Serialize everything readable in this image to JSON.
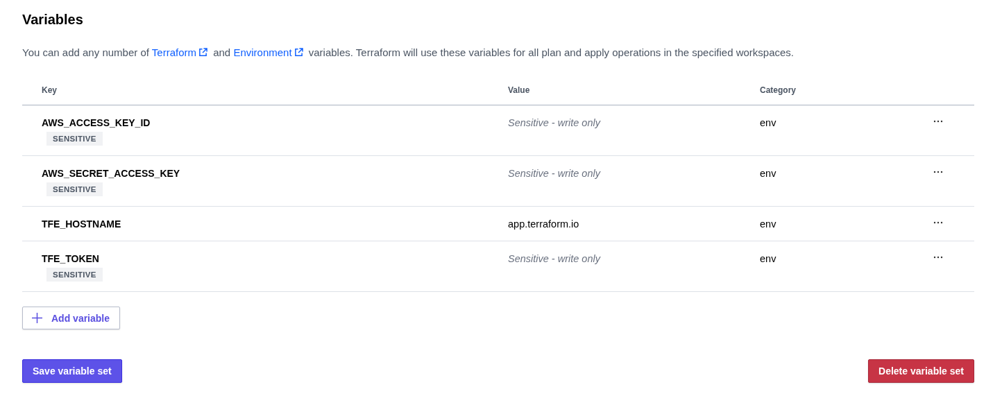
{
  "title": "Variables",
  "description": [
    {
      "kind": "text",
      "text": "You can add any number of "
    },
    {
      "kind": "link",
      "text": "Terraform"
    },
    {
      "kind": "text",
      "text": " and "
    },
    {
      "kind": "link",
      "text": "Environment"
    },
    {
      "kind": "text",
      "text": " variables. Terraform will use these variables for all plan and apply operations in the specified workspaces."
    }
  ],
  "table": {
    "columns": [
      "Key",
      "Value",
      "Category"
    ],
    "rows": [
      {
        "key": "AWS_ACCESS_KEY_ID",
        "badge": "SENSITIVE",
        "value": "Sensitive - write only",
        "masked": true,
        "category": "env"
      },
      {
        "key": "AWS_SECRET_ACCESS_KEY",
        "badge": "SENSITIVE",
        "value": "Sensitive - write only",
        "masked": true,
        "category": "env"
      },
      {
        "key": "TFE_HOSTNAME",
        "value": "app.terraform.io",
        "masked": false,
        "category": "env"
      },
      {
        "key": "TFE_TOKEN",
        "badge": "SENSITIVE",
        "value": "Sensitive - write only",
        "masked": true,
        "category": "env"
      }
    ]
  },
  "add_button": "Add variable",
  "save_button": "Save variable set",
  "delete_button": "Delete variable set"
}
